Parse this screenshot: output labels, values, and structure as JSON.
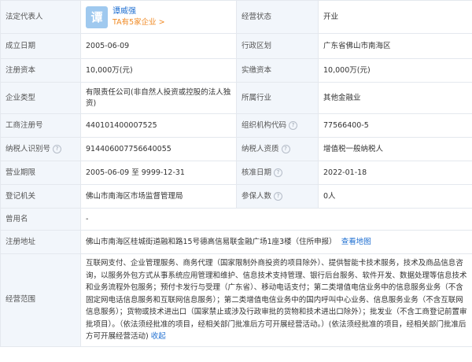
{
  "rows": {
    "legal_rep": {
      "label": "法定代表人",
      "avatar_char": "谭",
      "name": "谭威强",
      "link": "TA有5家企业 >"
    },
    "status": {
      "label": "经营状态",
      "value": "开业"
    },
    "established": {
      "label": "成立日期",
      "value": "2005-06-09"
    },
    "region": {
      "label": "行政区划",
      "value": "广东省佛山市南海区"
    },
    "reg_capital": {
      "label": "注册资本",
      "value": "10,000万(元)"
    },
    "paid_capital": {
      "label": "实缴资本",
      "value": "10,000万(元)"
    },
    "company_type": {
      "label": "企业类型",
      "value": "有限责任公司(非自然人投资或控股的法人独资)"
    },
    "industry": {
      "label": "所属行业",
      "value": "其他金融业"
    },
    "biz_reg_no": {
      "label": "工商注册号",
      "value": "440101400007525"
    },
    "org_code": {
      "label": "组织机构代码",
      "value": "77566400-5"
    },
    "taxpayer_id": {
      "label": "纳税人识别号",
      "value": "914406007756640055"
    },
    "taxpayer_qual": {
      "label": "纳税人资质",
      "value": "增值税一般纳税人"
    },
    "term": {
      "label": "营业期限",
      "value": "2005-06-09 至 9999-12-31"
    },
    "approval_date": {
      "label": "核准日期",
      "value": "2022-01-18"
    },
    "authority": {
      "label": "登记机关",
      "value": "佛山市南海区市场监督管理局"
    },
    "insured": {
      "label": "参保人数",
      "value": "0人"
    },
    "former_name": {
      "label": "曾用名",
      "value": "-"
    },
    "address": {
      "label": "注册地址",
      "value": "佛山市南海区桂城街道融和路15号德高信易联金融广场1座3楼（住所申报）",
      "link": "查看地图"
    },
    "scope": {
      "label": "经营范围",
      "value": "互联网支付、企业管理服务、商务代理（国家限制外商投资的项目除外）、提供智能卡技术服务，技术及商品信息咨询，以服务外包方式从事系统应用管理和维护、信息技术支持管理、银行后台服务、软件开发、数据处理等信息技术和业务流程外包服务；预付卡发行与受理（广东省）、移动电话支付；第二类增值电信业务中的信息服务业务（不含固定网电话信息服务和互联网信息服务）；第二类增值电信业务中的国内呼叫中心业务、信息服务业务（不含互联网信息服务）；货物或技术进出口（国家禁止或涉及行政审批的货物和技术进出口除外）；批发业（不含工商登记前置审批项目）。（依法须经批准的项目，经相关部门批准后方可开展经营活动。）(依法须经批准的项目，经相关部门批准后方可开展经营活动)",
      "collapse": "收起"
    }
  }
}
